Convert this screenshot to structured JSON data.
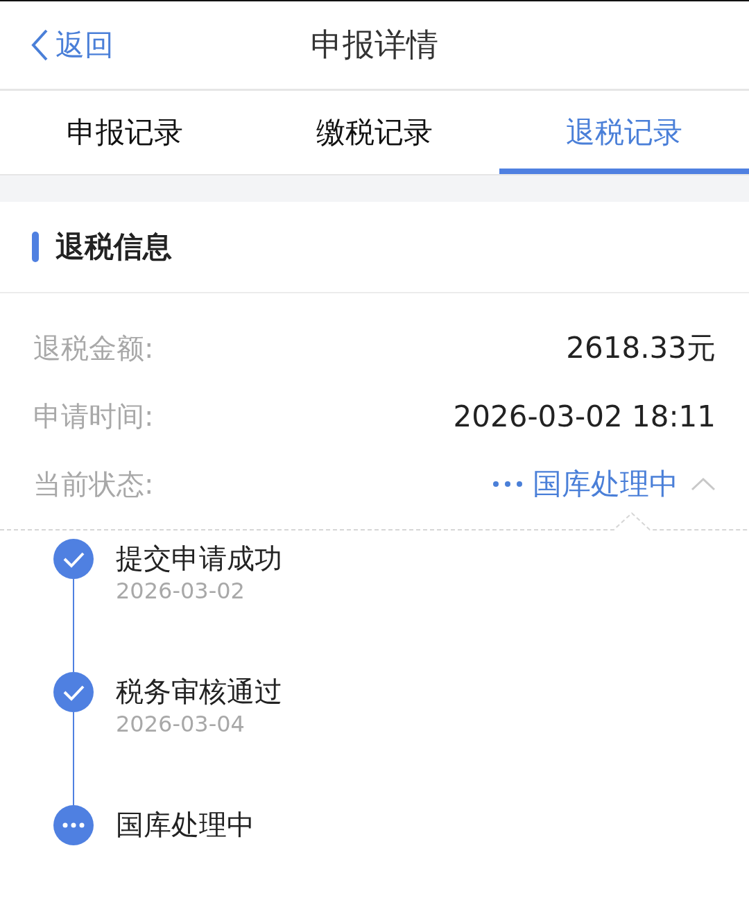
{
  "nav": {
    "back": "返回",
    "title": "申报详情"
  },
  "tabs": [
    {
      "label": "申报记录",
      "selected": false
    },
    {
      "label": "缴税记录",
      "selected": false
    },
    {
      "label": "退税记录",
      "selected": true
    }
  ],
  "section": {
    "title": "退税信息"
  },
  "fields": [
    {
      "label": "退税金额:",
      "value": "2618.33元",
      "kind": "text"
    },
    {
      "label": "申请时间:",
      "value": "2026-03-02 18:11",
      "kind": "text"
    },
    {
      "label": "当前状态:",
      "value": "国库处理中",
      "kind": "status",
      "expanded": true
    }
  ],
  "timeline": [
    {
      "title": "提交申请成功",
      "date": "2026-03-02",
      "kind": "done"
    },
    {
      "title": "税务审核通过",
      "date": "2026-03-04",
      "kind": "done"
    },
    {
      "title": "国库处理中",
      "kind": "pending"
    }
  ]
}
